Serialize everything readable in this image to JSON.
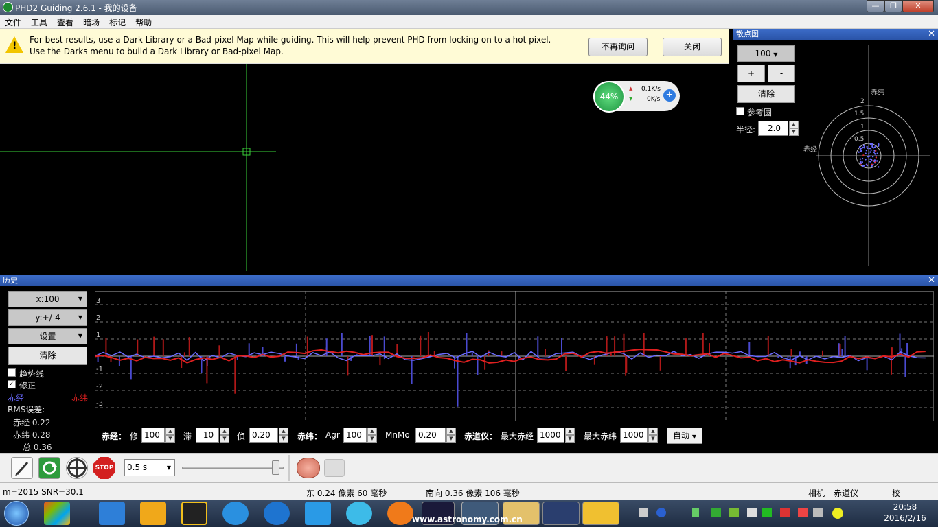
{
  "window": {
    "title": "PHD2 Guiding 2.6.1 - 我的设备",
    "min_glyph": "—",
    "max_glyph": "❐",
    "close_glyph": "✕"
  },
  "menu": [
    "文件",
    "工具",
    "查看",
    "暗场",
    "标记",
    "帮助"
  ],
  "alert": {
    "message": "For best results, use a Dark Library or a Bad-pixel Map while guiding. This will help prevent PHD from locking on to a hot pixel. Use the Darks menu to build a Dark Library or Bad-pixel Map.",
    "dont_ask": "不再询问",
    "close": "关闭"
  },
  "net_widget": {
    "percent": "44%",
    "up": "0.1K/s",
    "down": "0K/s"
  },
  "scatter": {
    "title": "散点图",
    "scale": "100",
    "plus": "+",
    "minus": "-",
    "clear": "清除",
    "ref_circle": "参考圆",
    "radius_label": "半径:",
    "radius_value": "2.0",
    "axis_dec": "赤纬",
    "axis_ra": "赤经",
    "rings": [
      "2",
      "1.5",
      "1",
      "0.5"
    ]
  },
  "history": {
    "title": "历史",
    "x_scale": "x:100",
    "y_scale": "y:+/-4",
    "settings": "设置",
    "clear": "清除",
    "trendline": "趋势线",
    "corrections": "修正",
    "legend_ra": "赤经",
    "legend_dec": "赤纬",
    "rms_title": "RMS误差:",
    "rms_ra": "赤经 0.22",
    "rms_dec": "赤纬 0.28",
    "rms_total": "总 0.36",
    "y_ticks": [
      "3",
      "2",
      "1",
      "-1",
      "-2",
      "-3"
    ],
    "colors": {
      "ra": "#6a6aff",
      "dec": "#e02020"
    }
  },
  "controls": {
    "ra_label": "赤经：",
    "ra_hyst_label": "修",
    "ra_hyst": "100",
    "ra_agg_label": "滞",
    "ra_agg": "10",
    "ra_min_label": "侦",
    "ra_min": "0.20",
    "dec_label": "赤纬：",
    "dec_agr_label": "Agr",
    "dec_agr": "100",
    "dec_mnmo_label": "MnMo",
    "dec_mnmo": "0.20",
    "mount_label": "赤道仪：",
    "max_ra_label": "最大赤经",
    "max_ra": "1000",
    "max_dec_label": "最大赤纬",
    "max_dec": "1000",
    "mode": "自动"
  },
  "toolbar": {
    "exposure": "0.5 s",
    "stop": "STOP"
  },
  "status": {
    "star": "m=2015 SNR=30.1",
    "ra": "东 0.24 像素  60 毫秒",
    "dec": "南向 0.36 像素 106 毫秒",
    "camera": "相机",
    "mount": "赤道仪",
    "cal": "校"
  },
  "taskbar": {
    "time": "20:58",
    "date": "2016/2/16",
    "watermark": "www.astronomy.com.cn"
  }
}
